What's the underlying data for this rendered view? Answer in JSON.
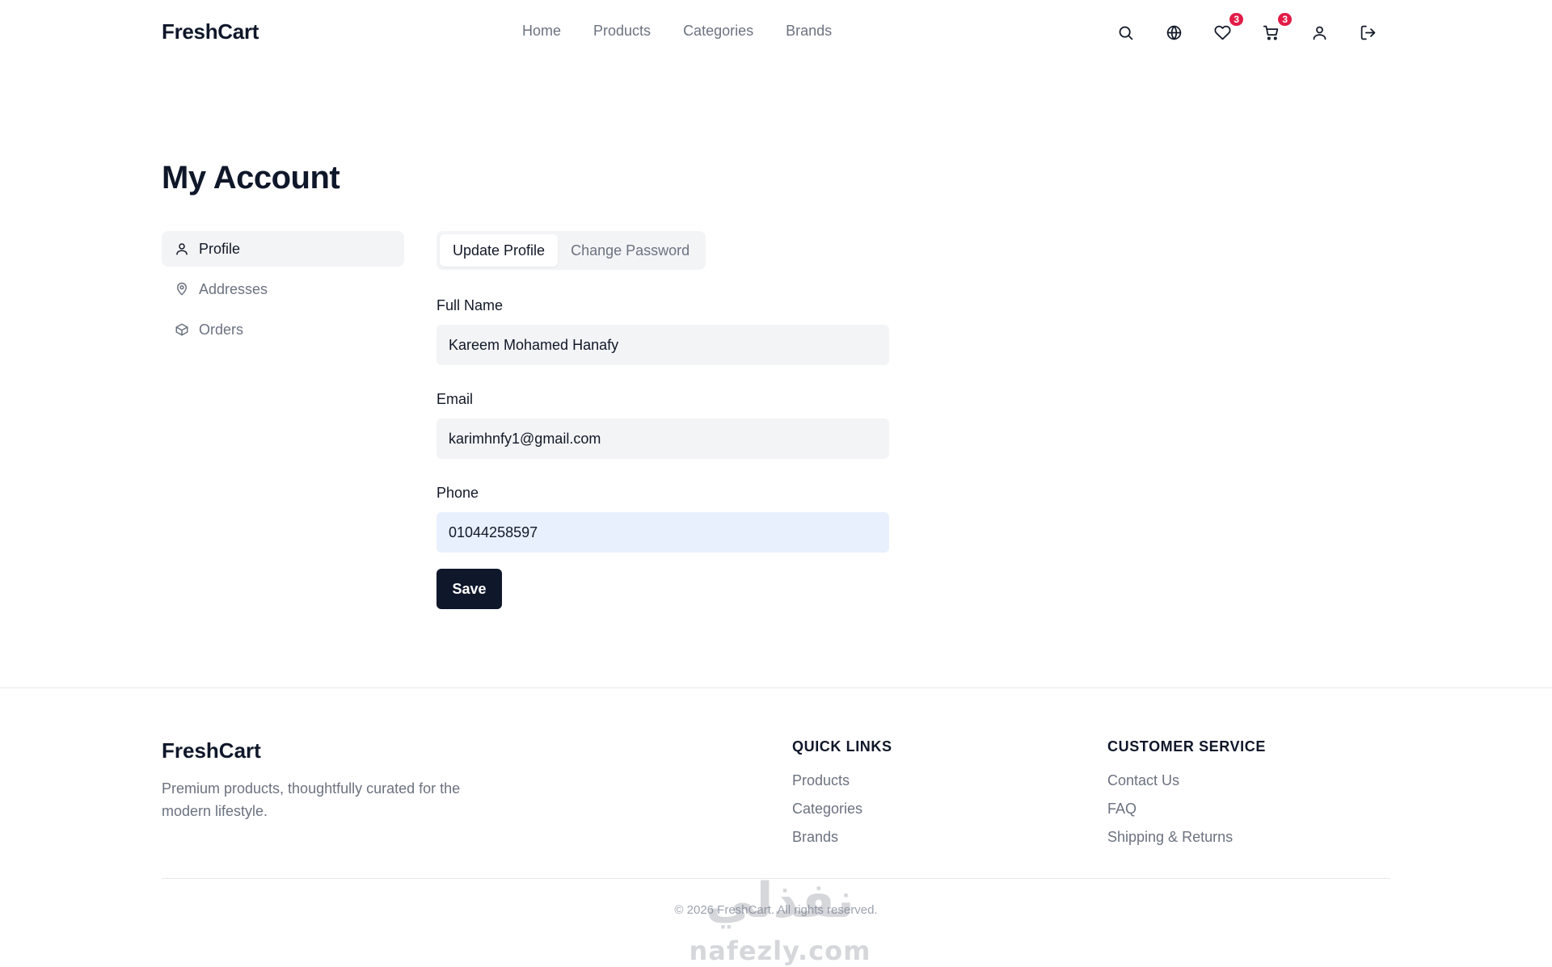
{
  "header": {
    "brand": "FreshCart",
    "nav": [
      "Home",
      "Products",
      "Categories",
      "Brands"
    ],
    "wishlist_count": "3",
    "cart_count": "3"
  },
  "page": {
    "title": "My Account"
  },
  "sidebar": {
    "items": [
      {
        "label": "Profile",
        "icon": "user-icon",
        "active": true
      },
      {
        "label": "Addresses",
        "icon": "map-pin-icon",
        "active": false
      },
      {
        "label": "Orders",
        "icon": "box-icon",
        "active": false
      }
    ]
  },
  "tabs": [
    {
      "label": "Update Profile",
      "active": true
    },
    {
      "label": "Change Password",
      "active": false
    }
  ],
  "form": {
    "full_name_label": "Full Name",
    "full_name_value": "Kareem Mohamed Hanafy",
    "email_label": "Email",
    "email_value": "karimhnfy1@gmail.com",
    "phone_label": "Phone",
    "phone_value": "01044258597",
    "save_label": "Save"
  },
  "footer": {
    "brand": "FreshCart",
    "description": "Premium products, thoughtfully curated for the modern lifestyle.",
    "quick_links": {
      "title": "QUICK LINKS",
      "links": [
        "Products",
        "Categories",
        "Brands"
      ]
    },
    "customer_service": {
      "title": "CUSTOMER SERVICE",
      "links": [
        "Contact Us",
        "FAQ",
        "Shipping & Returns"
      ]
    },
    "copyright": "© 2026 FreshCart. All rights reserved."
  },
  "watermark": {
    "arabic": "نفذلي",
    "latin": "nafezly.com"
  },
  "colors": {
    "primary": "#0f172a",
    "badge": "#e11d48",
    "muted": "#6b7280",
    "input_bg": "#f3f4f6"
  }
}
